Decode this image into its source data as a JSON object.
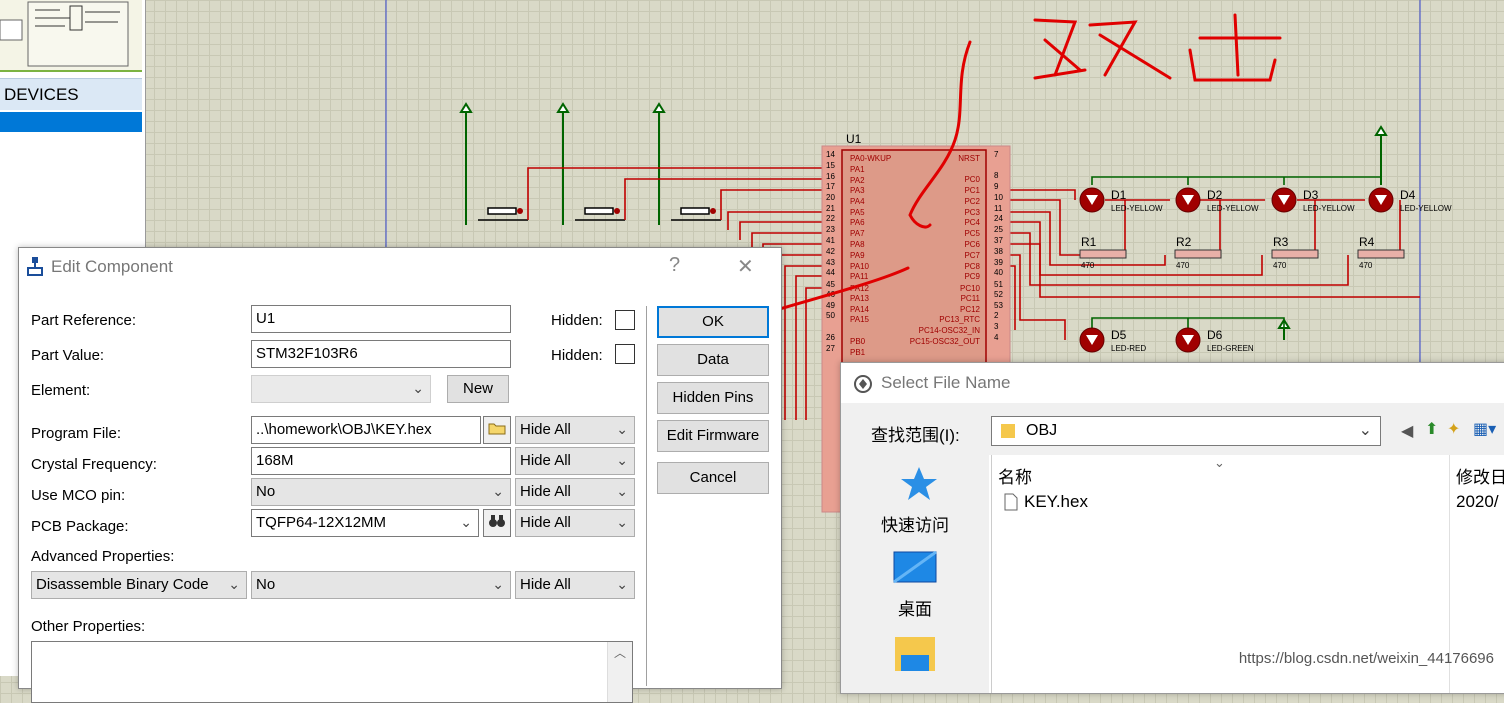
{
  "sidebar": {
    "devices_label": "DEVICES"
  },
  "schematic": {
    "chip": {
      "ref": "U1",
      "left_pins": [
        "PA0-WKUP",
        "PA1",
        "PA2",
        "PA3",
        "PA4",
        "PA5",
        "PA6",
        "PA7",
        "PA8",
        "PA9",
        "PA10",
        "PA11",
        "PA12",
        "PA13",
        "PA14",
        "PA15",
        "PB0",
        "PB1"
      ],
      "left_pin_nums": [
        "14",
        "15",
        "16",
        "17",
        "20",
        "21",
        "22",
        "23",
        "41",
        "42",
        "43",
        "44",
        "45",
        "46",
        "49",
        "50",
        "26",
        "27"
      ],
      "right_pins": [
        "NRST",
        "PC0",
        "PC1",
        "PC2",
        "PC3",
        "PC4",
        "PC5",
        "PC6",
        "PC7",
        "PC8",
        "PC9",
        "PC10",
        "PC11",
        "PC12",
        "PC13_RTC",
        "PC14-OSC32_IN",
        "PC15-OSC32_OUT"
      ],
      "right_pin_nums": [
        "7",
        "8",
        "9",
        "10",
        "11",
        "24",
        "25",
        "37",
        "38",
        "39",
        "40",
        "51",
        "52",
        "53",
        "2",
        "3",
        "4"
      ]
    },
    "leds": [
      {
        "ref": "D1",
        "value": "LED-YELLOW"
      },
      {
        "ref": "D2",
        "value": "LED-YELLOW"
      },
      {
        "ref": "D3",
        "value": "LED-YELLOW"
      },
      {
        "ref": "D4",
        "value": "LED-YELLOW"
      },
      {
        "ref": "D5",
        "value": "LED-RED"
      },
      {
        "ref": "D6",
        "value": "LED-GREEN"
      }
    ],
    "resistors": [
      {
        "ref": "R1",
        "value": "470"
      },
      {
        "ref": "R2",
        "value": "470"
      },
      {
        "ref": "R3",
        "value": "470"
      },
      {
        "ref": "R4",
        "value": "470"
      }
    ],
    "handwriting": "双击"
  },
  "edit_component": {
    "title": "Edit Component",
    "help": "?",
    "close": "✕",
    "part_reference_label": "Part Reference:",
    "part_reference": "U1",
    "part_value_label": "Part Value:",
    "part_value": "STM32F103R6",
    "hidden_label": "Hidden:",
    "element_label": "Element:",
    "new_button": "New",
    "program_file_label": "Program File:",
    "program_file": "..\\homework\\OBJ\\KEY.hex",
    "crystal_label": "Crystal Frequency:",
    "crystal": "168M",
    "mco_label": "Use MCO pin:",
    "mco": "No",
    "pcb_label": "PCB Package:",
    "pcb": "TQFP64-12X12MM",
    "hide_all": "Hide All",
    "advanced_label": "Advanced Properties:",
    "advanced_prop": "Disassemble Binary Code",
    "advanced_value": "No",
    "other_label": "Other Properties:",
    "buttons": {
      "ok": "OK",
      "data": "Data",
      "hidden_pins": "Hidden Pins",
      "edit_firmware": "Edit Firmware",
      "cancel": "Cancel"
    }
  },
  "select_file": {
    "title": "Select File Name",
    "look_in_label": "查找范围(I):",
    "look_in": "OBJ",
    "places": [
      "快速访问",
      "桌面"
    ],
    "col_name": "名称",
    "col_modified": "修改日",
    "files": [
      {
        "name": "KEY.hex",
        "modified": "2020/"
      }
    ]
  },
  "watermark": "https://blog.csdn.net/weixin_44176696"
}
